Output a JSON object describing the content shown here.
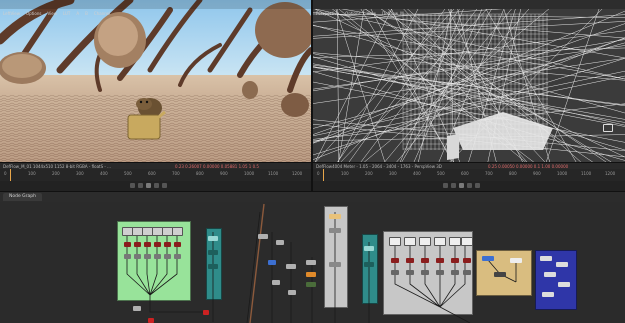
{
  "left_viewer": {
    "menu": [
      "LeftView",
      "Options",
      "View",
      "LUT",
      "A",
      "B",
      "Channel"
    ],
    "status": "DefFlow_M_01 1044x510 1152 8-bit RGBA - floatS - ...",
    "values": "0.23  0.26007  0.00000  0.05881  1.05  1  0.5"
  },
  "right_viewer": {
    "menu": [
      "Perspective",
      "Options",
      "View",
      "DefFlow_M"
    ],
    "status": "DefFlow4004 Meter - 1.05 - 2064 - 3404 - 1763 - PerspView 3D",
    "values": "0.25  0.00050  0.00000  0.1  1.00  0.00000"
  },
  "timeline": {
    "left_ticks": [
      "0",
      "100",
      "200",
      "300",
      "400",
      "500",
      "600",
      "700",
      "800",
      "900",
      "1000",
      "1100",
      "1200"
    ],
    "right_ticks": [
      "0",
      "100",
      "200",
      "300",
      "400",
      "500",
      "600",
      "700",
      "800",
      "900",
      "1000",
      "1100",
      "1200"
    ]
  },
  "node_editor": {
    "tab_label": "Node Graph"
  },
  "colors": {
    "group_green": "#98e39a",
    "group_teal": "#2f8c8a",
    "group_gray": "#c7c7c7",
    "group_tan": "#d9bd80",
    "group_blue": "#2f36a8",
    "node_gray": "#b0b0b0"
  }
}
